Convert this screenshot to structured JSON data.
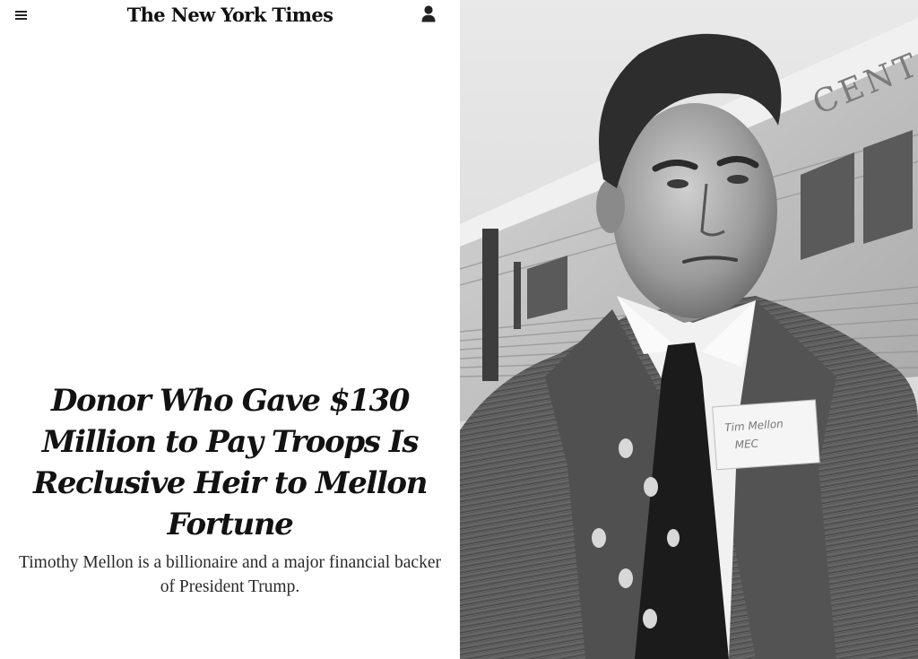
{
  "header": {
    "menu_icon": "hamburger-menu-icon",
    "logo_text": "The New York Times",
    "user_icon": "user-account-icon"
  },
  "article": {
    "headline": "Donor Who Gave $130 Million to Pay Troops Is Reclusive Heir to Mellon Fortune",
    "summary": "Timothy Mellon is a billionaire and a major financial backer of President Trump."
  },
  "photo": {
    "name_tag_text": [
      "Tim Mellon",
      "MEC"
    ],
    "train_text": "CENT"
  },
  "colors": {
    "text": "#121212",
    "background": "#ffffff"
  }
}
